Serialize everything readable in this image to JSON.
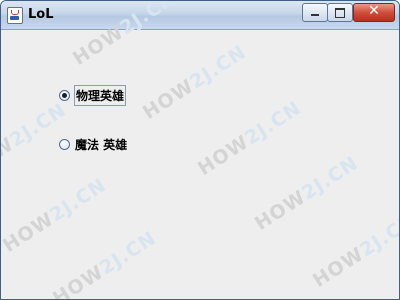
{
  "window": {
    "title": "LoL",
    "close_symbol": "✕"
  },
  "watermark": {
    "text": "HOW2J.CN",
    "part1": "HOW",
    "part2": "2J.CN"
  },
  "options": [
    {
      "label": "物理英雄",
      "selected": true
    },
    {
      "label": "魔法 英雄",
      "selected": false
    }
  ],
  "icons": {
    "app": "java-app-icon",
    "minimize": "minimize-icon",
    "maximize": "maximize-icon",
    "close": "close-icon",
    "radio_on": "radio-selected-icon",
    "radio_off": "radio-unselected-icon"
  },
  "colors": {
    "titlebar": "#c6d6ea",
    "close_button": "#cf4e3a",
    "content_bg": "#eeeeee"
  }
}
